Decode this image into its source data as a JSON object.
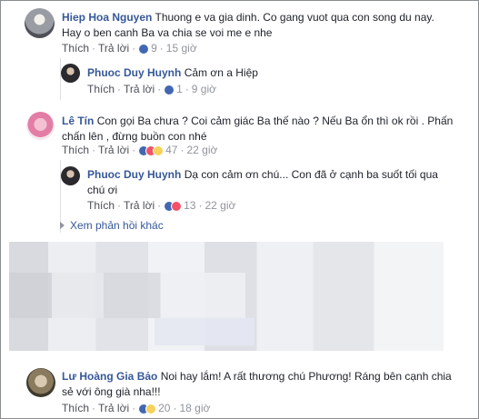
{
  "comments": [
    {
      "author": "Hiep Hoa Nguyen",
      "text_line1": "Thuong e va gia dinh. Co gang vuot qua con song du nay.",
      "text_line2": "Hay o ben canh Ba va chia se voi me e nhe",
      "like": "Thích",
      "reply": "Trả lời",
      "reactions": "9",
      "time": "15 giờ"
    },
    {
      "author": "Phuoc Duy Huynh",
      "text": "Cảm ơn a Hiệp",
      "like": "Thích",
      "reply": "Trả lời",
      "reactions": "1",
      "time": "9 giờ"
    },
    {
      "author": "Lê Tín",
      "text_line1": "Con gọi Ba chưa ? Coi cảm giác Ba thế nào ? Nếu Ba ổn thì ok rồi . Phấn",
      "text_line2": "chấn lên , đừng buồn con nhé",
      "like": "Thích",
      "reply": "Trả lời",
      "reactions": "47",
      "time": "22 giờ"
    },
    {
      "author": "Phuoc Duy Huynh",
      "text_line1": "Dạ con cảm ơn chú... Con đã ở cạnh ba suốt tối qua",
      "text_line2": "chú ơi",
      "like": "Thích",
      "reply": "Trả lời",
      "reactions": "13",
      "time": "22 giờ"
    },
    {
      "author": "Lư Hoàng Gia Bảo",
      "text_line1": "Noi hay lắm! A rất thương chú Phương! Ráng bên cạnh chia",
      "text_line2": "sẻ với ông già nha!!!",
      "like": "Thích",
      "reply": "Trả lời",
      "reactions": "20",
      "time": "18 giờ"
    }
  ],
  "more_replies": "Xem phản hồi khác",
  "colors": {
    "name": "#365899",
    "meta": "#90949c",
    "text": "#1d2129"
  }
}
